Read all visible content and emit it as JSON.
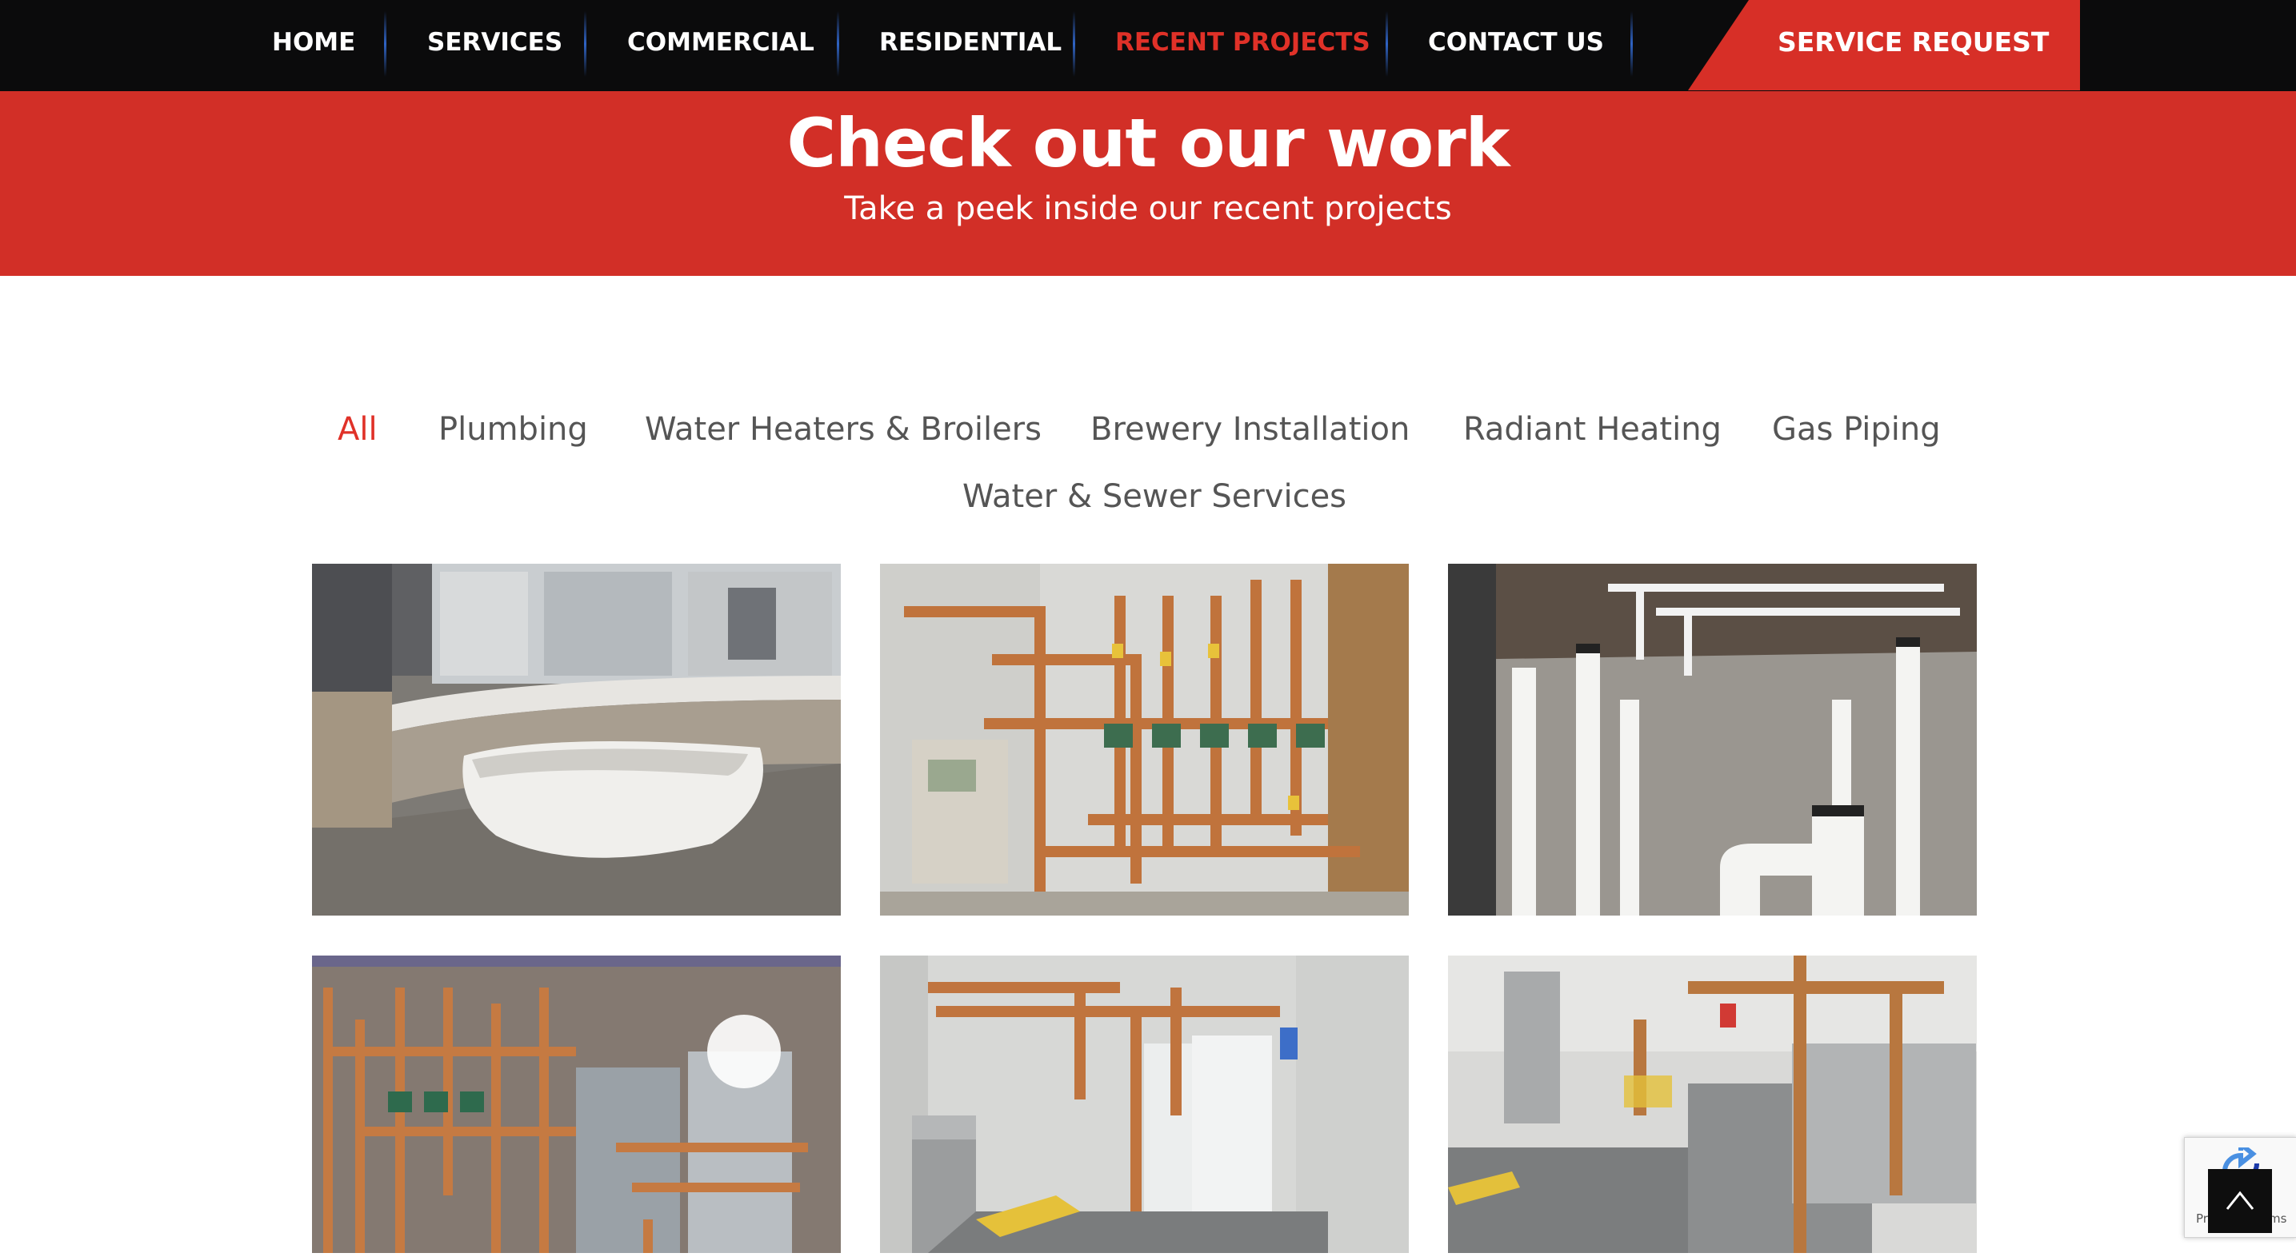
{
  "nav": {
    "items": [
      {
        "label": "HOME"
      },
      {
        "label": "SERVICES"
      },
      {
        "label": "COMMERCIAL"
      },
      {
        "label": "RESIDENTIAL"
      },
      {
        "label": "RECENT PROJECTS",
        "active": true
      },
      {
        "label": "CONTACT US"
      }
    ],
    "service_request": "SERVICE REQUEST"
  },
  "hero": {
    "title": "Check out our work",
    "subtitle": "Take a peek inside our recent projects"
  },
  "filters": [
    {
      "label": "All",
      "active": true
    },
    {
      "label": "Plumbing"
    },
    {
      "label": "Water Heaters & Broilers"
    },
    {
      "label": "Brewery Installation"
    },
    {
      "label": "Radiant Heating"
    },
    {
      "label": "Gas Piping"
    },
    {
      "label": "Water & Sewer Services"
    }
  ],
  "gallery": [
    {
      "subject": "freestanding bathtub"
    },
    {
      "subject": "boiler with copper piping"
    },
    {
      "subject": "pvc pipes in foundation"
    },
    {
      "subject": "water heaters with copper manifold"
    },
    {
      "subject": "mighty therm2 boiler room"
    },
    {
      "subject": "mighty therm2 boilers"
    }
  ],
  "recaptcha": {
    "text": "Privacy - Terms"
  },
  "colors": {
    "brand_red": "#d22f27",
    "active_red": "#e03128",
    "nav_bg": "#0b0b0c",
    "separator_blue": "#2f63c4",
    "filter_gray": "#555555"
  }
}
